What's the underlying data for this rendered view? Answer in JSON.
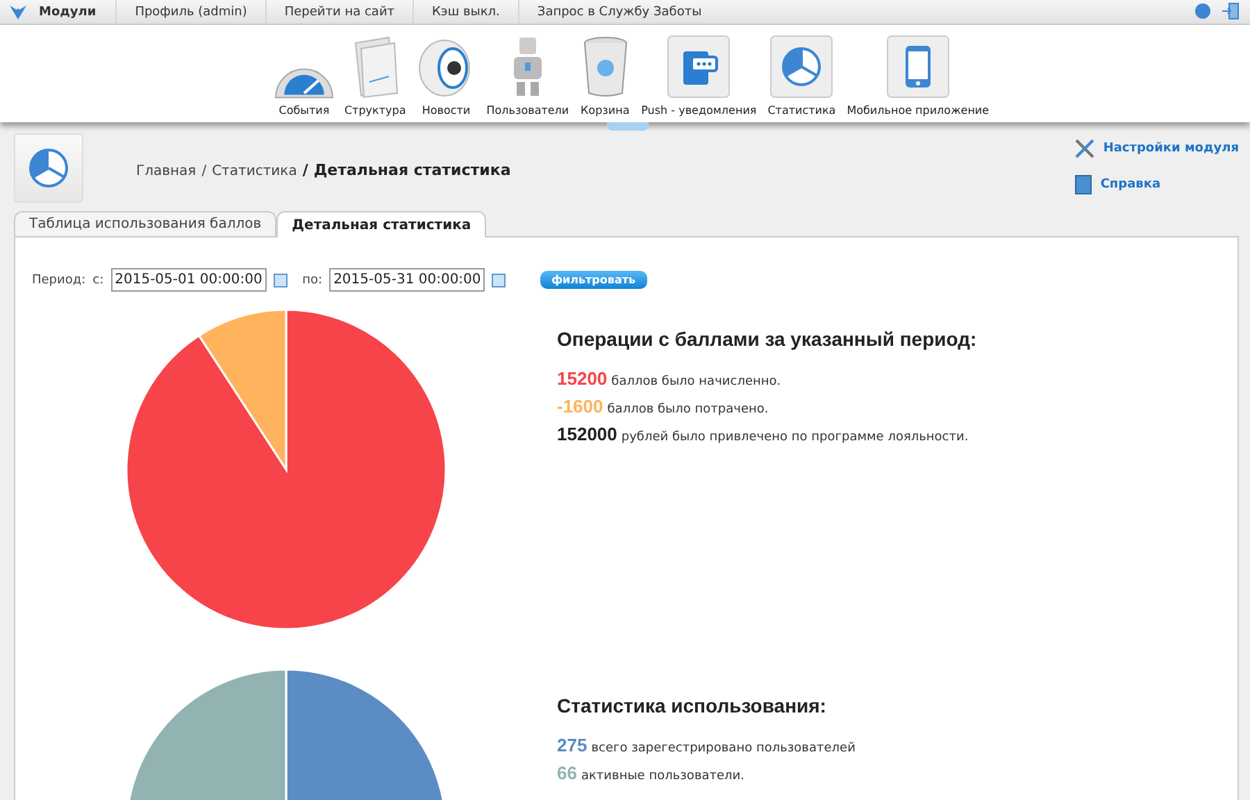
{
  "top_bar": {
    "title": "Модули",
    "items": [
      "Профиль (admin)",
      "Перейти на сайт",
      "Кэш выкл.",
      "Запрос в Службу Заботы"
    ]
  },
  "toolbar": {
    "items": [
      {
        "label": "События",
        "kind": "gauge"
      },
      {
        "label": "Структура",
        "kind": "folder"
      },
      {
        "label": "Новости",
        "kind": "speaker"
      },
      {
        "label": "Пользователи",
        "kind": "robot"
      },
      {
        "label": "Корзина",
        "kind": "bin"
      },
      {
        "label": "Push - уведомления",
        "kind": "push"
      },
      {
        "label": "Статистика",
        "kind": "pie"
      },
      {
        "label": "Мобильное приложение",
        "kind": "phone"
      }
    ]
  },
  "breadcrumb": {
    "links": [
      "Главная",
      "Статистика"
    ],
    "separators": [
      "/",
      "/"
    ],
    "current": "Детальная статистика"
  },
  "side_links": [
    {
      "label": "Настройки модуля",
      "kind": "tools"
    },
    {
      "label": "Справка",
      "kind": "help"
    }
  ],
  "tabs": [
    {
      "label": "Таблица использования баллов",
      "selected": false
    },
    {
      "label": "Детальная статистика",
      "selected": true
    }
  ],
  "filter": {
    "period_label": "Период:",
    "from_label": "с:",
    "from_value": "2015-05-01 00:00:00",
    "to_label": "по:",
    "to_value": "2015-05-31 00:00:00",
    "button": "фильтровать"
  },
  "sections": [
    {
      "title": "Операции с баллами за указанный период:",
      "stats": [
        {
          "value": "15200",
          "text": "баллов было начисленно.",
          "color": "#f6444a"
        },
        {
          "value": "-1600",
          "text": "баллов было потрачено.",
          "color": "#ffb35c"
        },
        {
          "value": "152000",
          "text": "рублей было привлечено по программе лояльности.",
          "color": "#222222"
        }
      ]
    },
    {
      "title": "Статистика использования:",
      "stats": [
        {
          "value": "275",
          "text": "всего зарегестрировано пользователей",
          "color": "#5b8cc4"
        },
        {
          "value": "66",
          "text": "активные пользователи.",
          "color": "#93b3b3"
        }
      ]
    }
  ]
}
